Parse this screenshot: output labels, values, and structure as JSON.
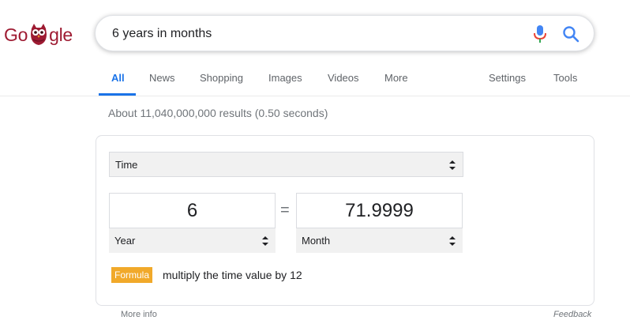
{
  "logo": {
    "part1": "Go",
    "part2": "gle"
  },
  "search": {
    "query": "6 years in months"
  },
  "tabs": [
    {
      "label": "All"
    },
    {
      "label": "News"
    },
    {
      "label": "Shopping"
    },
    {
      "label": "Images"
    },
    {
      "label": "Videos"
    },
    {
      "label": "More"
    },
    {
      "label": "Settings"
    },
    {
      "label": "Tools"
    }
  ],
  "result_stats": "About 11,040,000,000 results (0.50 seconds)",
  "converter": {
    "category": "Time",
    "from": {
      "value": "6",
      "unit": "Year"
    },
    "equals": "=",
    "to": {
      "value": "71.9999",
      "unit": "Month"
    },
    "formula_label": "Formula",
    "formula_text": "multiply the time value by 12"
  },
  "footer": {
    "more_info": "More info",
    "feedback": "Feedback"
  },
  "colors": {
    "accent": "#1a73e8",
    "logo": "#9e1b32",
    "formula_badge": "#f1a92a",
    "muted": "#70757a"
  }
}
